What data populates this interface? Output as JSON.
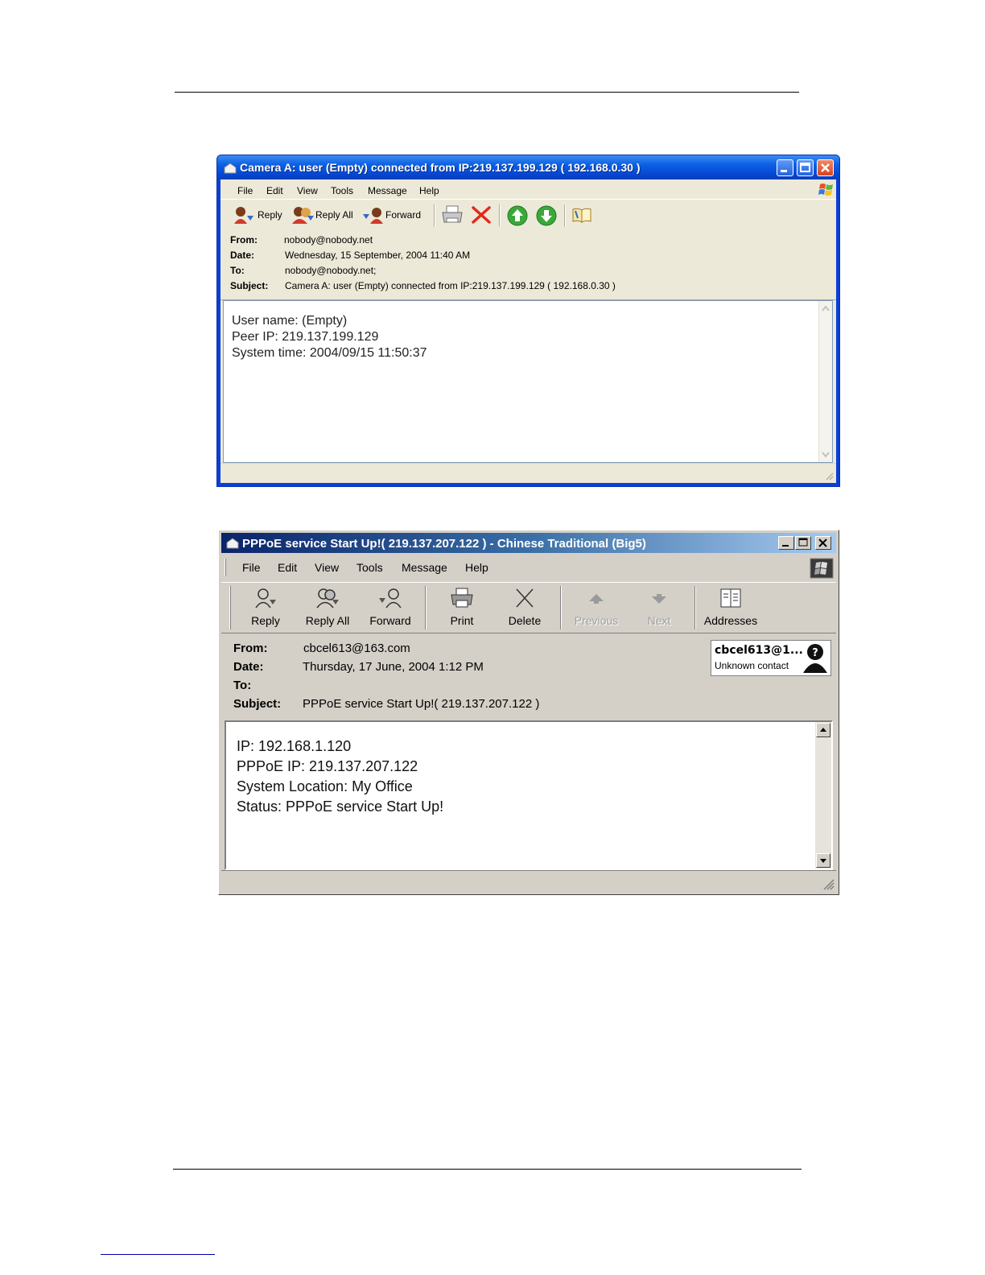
{
  "window1": {
    "title": "Camera A: user (Empty) connected from IP:219.137.199.129 ( 192.168.0.30 )",
    "menu": [
      "File",
      "Edit",
      "View",
      "Tools",
      "Message",
      "Help"
    ],
    "toolbar": {
      "reply": "Reply",
      "reply_all": "Reply All",
      "forward": "Forward"
    },
    "header": {
      "from_label": "From:",
      "from": "nobody@nobody.net",
      "date_label": "Date:",
      "date": "Wednesday, 15 September, 2004 11:40 AM",
      "to_label": "To:",
      "to": "nobody@nobody.net;",
      "subject_label": "Subject:",
      "subject": "Camera A: user (Empty) connected from IP:219.137.199.129 ( 192.168.0.30 )"
    },
    "body_lines": [
      "User name: (Empty)",
      "Peer IP: 219.137.199.129",
      "System time: 2004/09/15 11:50:37"
    ]
  },
  "window2": {
    "title": "PPPoE service Start Up!( 219.137.207.122 ) - Chinese Traditional (Big5)",
    "menu": [
      "File",
      "Edit",
      "View",
      "Tools",
      "Message",
      "Help"
    ],
    "toolbar": {
      "reply": "Reply",
      "reply_all": "Reply All",
      "forward": "Forward",
      "print": "Print",
      "delete": "Delete",
      "previous": "Previous",
      "next": "Next",
      "addresses": "Addresses"
    },
    "header": {
      "from_label": "From:",
      "from": "cbcel613@163.com",
      "date_label": "Date:",
      "date": "Thursday, 17 June, 2004 1:12 PM",
      "to_label": "To:",
      "to": "",
      "subject_label": "Subject:",
      "subject": "PPPoE service Start Up!( 219.137.207.122 )"
    },
    "contact": {
      "name": "cbcel613@1...",
      "status": "Unknown contact"
    },
    "body_lines": [
      "IP: 192.168.1.120",
      "PPPoE IP: 219.137.207.122",
      "System Location: My Office",
      "Status: PPPoE service Start Up!"
    ]
  }
}
